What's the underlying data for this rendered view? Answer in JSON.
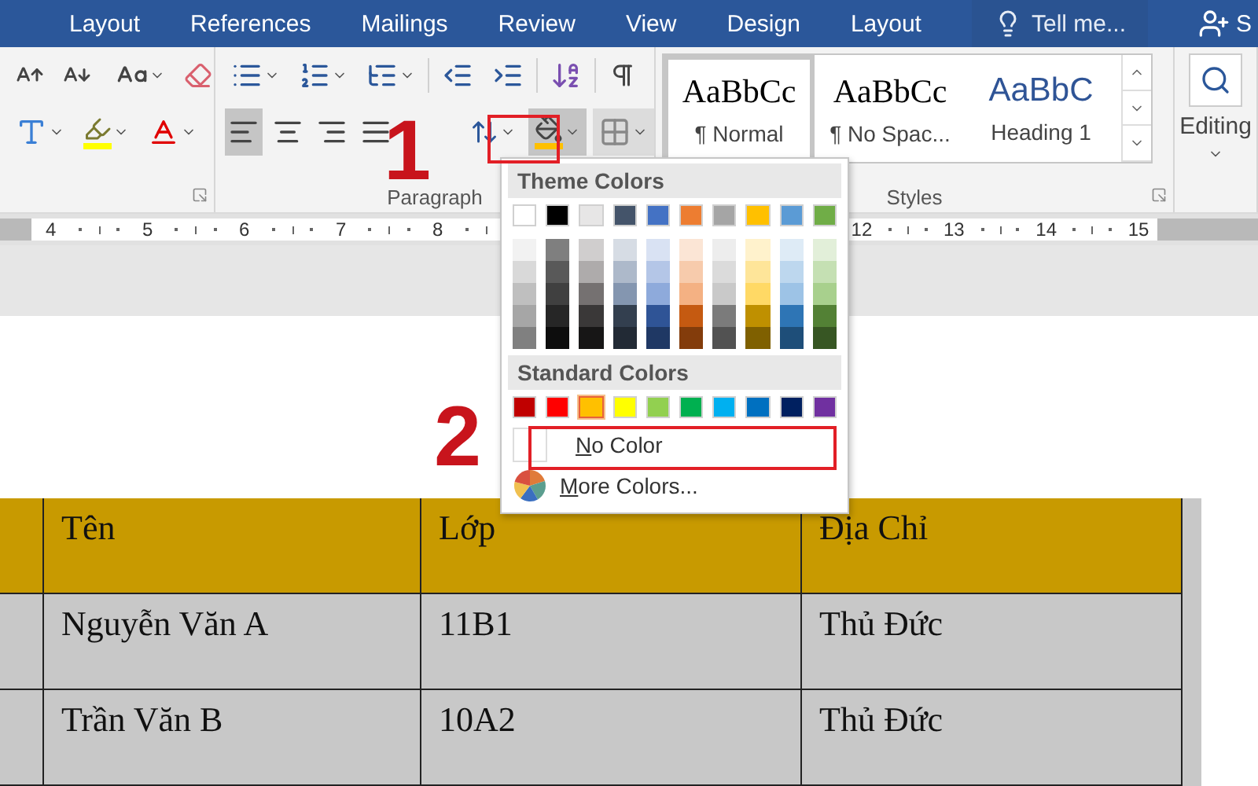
{
  "ribbon_tabs": [
    {
      "label": "Layout",
      "selected": false
    },
    {
      "label": "References",
      "selected": false
    },
    {
      "label": "Mailings",
      "selected": false
    },
    {
      "label": "Review",
      "selected": false
    },
    {
      "label": "View",
      "selected": false
    },
    {
      "label": "Design",
      "selected": false
    },
    {
      "label": "Layout",
      "selected": false
    }
  ],
  "tell_me": {
    "placeholder": "Tell me..."
  },
  "share": {
    "label": "S"
  },
  "paragraph_group": {
    "label": "Paragraph",
    "alignments": [
      {
        "kind": "left",
        "selected": true
      },
      {
        "kind": "center",
        "selected": false
      },
      {
        "kind": "right",
        "selected": false
      },
      {
        "kind": "justify",
        "selected": false
      }
    ]
  },
  "styles_group": {
    "label": "Styles",
    "items": [
      {
        "preview": "AaBbCc",
        "name": "¶ Normal",
        "kind": "serif",
        "selected": true
      },
      {
        "preview": "AaBbCc",
        "name": "¶ No Spac...",
        "kind": "serif",
        "selected": false
      },
      {
        "preview": "AaBbC",
        "name": "Heading 1",
        "kind": "heading",
        "selected": false
      }
    ]
  },
  "editing_group": {
    "label": "Editing"
  },
  "ruler": {
    "left_marks": [
      "4",
      "5",
      "6",
      "7",
      "8"
    ],
    "right_marks": [
      "12",
      "13",
      "14",
      "15"
    ]
  },
  "shading_menu": {
    "theme_title": "Theme Colors",
    "theme_columns": [
      {
        "color": "#ffffff",
        "shades": [
          {
            "color": "#f2f2f2"
          },
          {
            "color": "#d9d9d9"
          },
          {
            "color": "#bfbfbf"
          },
          {
            "color": "#a6a6a6"
          },
          {
            "color": "#808080"
          }
        ]
      },
      {
        "color": "#000000",
        "shades": [
          {
            "color": "#7f7f7f"
          },
          {
            "color": "#595959"
          },
          {
            "color": "#404040"
          },
          {
            "color": "#262626"
          },
          {
            "color": "#0d0d0d"
          }
        ]
      },
      {
        "color": "#e7e6e6",
        "shades": [
          {
            "color": "#d0cece"
          },
          {
            "color": "#aeabab"
          },
          {
            "color": "#757171"
          },
          {
            "color": "#3a3838"
          },
          {
            "color": "#171616"
          }
        ]
      },
      {
        "color": "#44546a",
        "shades": [
          {
            "color": "#d6dce4"
          },
          {
            "color": "#adb9ca"
          },
          {
            "color": "#8496b0"
          },
          {
            "color": "#333f4f"
          },
          {
            "color": "#222a35"
          }
        ]
      },
      {
        "color": "#4472c4",
        "shades": [
          {
            "color": "#d9e2f3"
          },
          {
            "color": "#b4c6e7"
          },
          {
            "color": "#8eaadb"
          },
          {
            "color": "#2f5496"
          },
          {
            "color": "#1f3864"
          }
        ]
      },
      {
        "color": "#ed7d31",
        "shades": [
          {
            "color": "#fbe5d5"
          },
          {
            "color": "#f7cbac"
          },
          {
            "color": "#f4b183"
          },
          {
            "color": "#c55a11"
          },
          {
            "color": "#833c0b"
          }
        ]
      },
      {
        "color": "#a5a5a5",
        "shades": [
          {
            "color": "#ededed"
          },
          {
            "color": "#dbdbdb"
          },
          {
            "color": "#c9c9c9"
          },
          {
            "color": "#7b7b7b"
          },
          {
            "color": "#525252"
          }
        ]
      },
      {
        "color": "#ffc000",
        "shades": [
          {
            "color": "#fff2cc"
          },
          {
            "color": "#fee599"
          },
          {
            "color": "#ffd965"
          },
          {
            "color": "#bf9000"
          },
          {
            "color": "#7f6000"
          }
        ]
      },
      {
        "color": "#5b9bd5",
        "shades": [
          {
            "color": "#deebf6"
          },
          {
            "color": "#bdd7ee"
          },
          {
            "color": "#9dc3e6"
          },
          {
            "color": "#2e75b5"
          },
          {
            "color": "#1e4e79"
          }
        ]
      },
      {
        "color": "#70ad47",
        "shades": [
          {
            "color": "#e2efd9"
          },
          {
            "color": "#c5e0b3"
          },
          {
            "color": "#a8d08d"
          },
          {
            "color": "#538135"
          },
          {
            "color": "#375623"
          }
        ]
      }
    ],
    "standard_title": "Standard Colors",
    "standard_colors": [
      {
        "color": "#c00000",
        "selected": false
      },
      {
        "color": "#ff0000",
        "selected": false
      },
      {
        "color": "#ffc000",
        "selected": true
      },
      {
        "color": "#ffff00",
        "selected": false
      },
      {
        "color": "#92d050",
        "selected": false
      },
      {
        "color": "#00b050",
        "selected": false
      },
      {
        "color": "#00b0f0",
        "selected": false
      },
      {
        "color": "#0070c0",
        "selected": false
      },
      {
        "color": "#002060",
        "selected": false
      },
      {
        "color": "#7030a0",
        "selected": false
      }
    ],
    "no_color": "No Color",
    "more_colors": "More Colors..."
  },
  "step_labels": [
    "1",
    "2"
  ],
  "table": {
    "columns": [
      "Tên",
      "Lớp",
      "Địa Chỉ"
    ],
    "rows": [
      [
        "Nguyễn Văn A",
        "11B1",
        "Thủ Đức"
      ],
      [
        "Trần Văn B",
        "10A2",
        "Thủ Đức"
      ]
    ]
  }
}
